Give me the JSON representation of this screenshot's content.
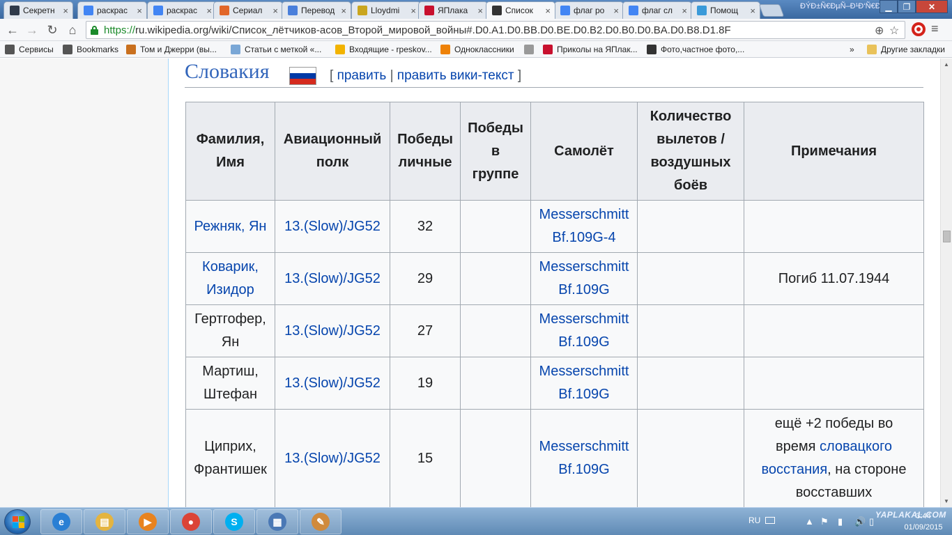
{
  "browser": {
    "tabs": [
      {
        "label": "Секретн",
        "favicon": "dark-square-icon",
        "color": "#2f3a4a"
      },
      {
        "label": "раскрас",
        "favicon": "google-icon",
        "color": "#4285f4"
      },
      {
        "label": "раскрас",
        "favicon": "google-icon",
        "color": "#4285f4"
      },
      {
        "label": "Сериал",
        "favicon": "leaf-icon",
        "color": "#e2672a"
      },
      {
        "label": "Перевод",
        "favicon": "translate-icon",
        "color": "#4a7fdb"
      },
      {
        "label": "Lloydmi",
        "favicon": "yellow-globe-icon",
        "color": "#c9a51e"
      },
      {
        "label": "ЯПлака",
        "favicon": "yaplakal-icon",
        "color": "#c8102e"
      },
      {
        "label": "Список",
        "favicon": "wikipedia-icon",
        "color": "#333333",
        "active": true
      },
      {
        "label": "флаг ро",
        "favicon": "google-g-icon",
        "color": "#4285f4"
      },
      {
        "label": "флаг сл",
        "favicon": "google-g-icon",
        "color": "#4285f4"
      },
      {
        "label": "Помощ",
        "favicon": "help-globe-icon",
        "color": "#3a9ad9"
      }
    ],
    "profile_name": "ÐÝÐ±Ñ€ÐµÑ–Ð¹Ð‘Ñ€Ð›ÐƒÐ³Ñ‹",
    "url_scheme": "https://",
    "url_rest": "ru.wikipedia.org/wiki/Список_лётчиков-асов_Второй_мировой_войны#.D0.A1.D0.BB.D0.BE.D0.B2.D0.B0.D0.BA.D0.B8.D1.8F",
    "bookmarks": [
      {
        "label": "Сервисы",
        "icon": "apps-grid-icon"
      },
      {
        "label": "Bookmarks",
        "icon": "star-icon"
      },
      {
        "label": "Том и Джерри (вы...",
        "icon": "cat-icon"
      },
      {
        "label": "Статьи с меткой «...",
        "icon": "shield-icon"
      },
      {
        "label": "Входящие - rpeskov...",
        "icon": "mail-icon"
      },
      {
        "label": "Одноклассники",
        "icon": "ok-icon"
      },
      {
        "label": "",
        "icon": "page-icon"
      },
      {
        "label": "Приколы на ЯПлак...",
        "icon": "yaplakal-icon"
      },
      {
        "label": "Фото,частное фото,...",
        "icon": "film-icon"
      }
    ],
    "bookmarks_overflow": "»",
    "other_bookmarks": "Другие закладки"
  },
  "page": {
    "section_title": "Словакия",
    "edit_open": "[",
    "edit_link": "править",
    "edit_sep": "|",
    "edit_source_link": "править вики-текст",
    "edit_close": "]",
    "flag_colors": [
      "#ffffff",
      "#0039a6",
      "#d52b1e"
    ],
    "table": {
      "headers": [
        [
          "Фамилия,",
          "Имя"
        ],
        [
          "Авиационный",
          "полк"
        ],
        [
          "Победы",
          "личные"
        ],
        [
          "Победы",
          "в",
          "группе"
        ],
        [
          "Самолёт"
        ],
        [
          "Количество",
          "вылетов /",
          "воздушных",
          "боёв"
        ],
        [
          "Примечания"
        ]
      ],
      "rows": [
        {
          "name": [
            "Режняк, Ян"
          ],
          "name_link": true,
          "regiment": "13.(Slow)/JG52",
          "wins": "32",
          "group": "",
          "plane": [
            "Messerschmitt",
            "Bf.109G-4"
          ],
          "sorties": "",
          "notes": []
        },
        {
          "name": [
            "Коварик,",
            "Изидор"
          ],
          "name_link": true,
          "regiment": "13.(Slow)/JG52",
          "wins": "29",
          "group": "",
          "plane": [
            "Messerschmitt",
            "Bf.109G"
          ],
          "sorties": "",
          "notes": [
            {
              "t": "Погиб 11.07.1944",
              "link": false
            }
          ]
        },
        {
          "name": [
            "Гертгофер,",
            "Ян"
          ],
          "name_link": false,
          "regiment": "13.(Slow)/JG52",
          "wins": "27",
          "group": "",
          "plane": [
            "Messerschmitt",
            "Bf.109G"
          ],
          "sorties": "",
          "notes": []
        },
        {
          "name": [
            "Мартиш,",
            "Штефан"
          ],
          "name_link": false,
          "regiment": "13.(Slow)/JG52",
          "wins": "19",
          "group": "",
          "plane": [
            "Messerschmitt",
            "Bf.109G"
          ],
          "sorties": "",
          "notes": []
        },
        {
          "name": [
            "Циприх,",
            "Франтишек"
          ],
          "name_link": false,
          "regiment": "13.(Slow)/JG52",
          "wins": "15",
          "group": "",
          "plane": [
            "Messerschmitt",
            "Bf.109G"
          ],
          "sorties": "",
          "notes": [
            {
              "t": "ещё +2 победы во",
              "link": false,
              "br": true
            },
            {
              "t": "время ",
              "link": false
            },
            {
              "t": "словацкого",
              "link": true,
              "br": true
            },
            {
              "t": "восстания",
              "link": true
            },
            {
              "t": ", на стороне",
              "link": false,
              "br": true
            },
            {
              "t": "восставших",
              "link": false
            }
          ]
        }
      ]
    }
  },
  "taskbar": {
    "apps": [
      {
        "name": "ie-icon",
        "color": "#2a7fd4",
        "glyph": "e"
      },
      {
        "name": "explorer-folder-icon",
        "color": "#e4b440",
        "glyph": "▤"
      },
      {
        "name": "media-player-icon",
        "color": "#e8831f",
        "glyph": "▶"
      },
      {
        "name": "chrome-icon",
        "color": "#db4437",
        "glyph": "●"
      },
      {
        "name": "skype-icon",
        "color": "#00aff0",
        "glyph": "S"
      },
      {
        "name": "control-panel-icon",
        "color": "#4a78b5",
        "glyph": "▦"
      },
      {
        "name": "paint-icon",
        "color": "#d08a3c",
        "glyph": "✎"
      }
    ],
    "language": "RU",
    "time": "3:44",
    "date": "01/09/2015",
    "watermark": "YAPLAKAL.COM"
  }
}
